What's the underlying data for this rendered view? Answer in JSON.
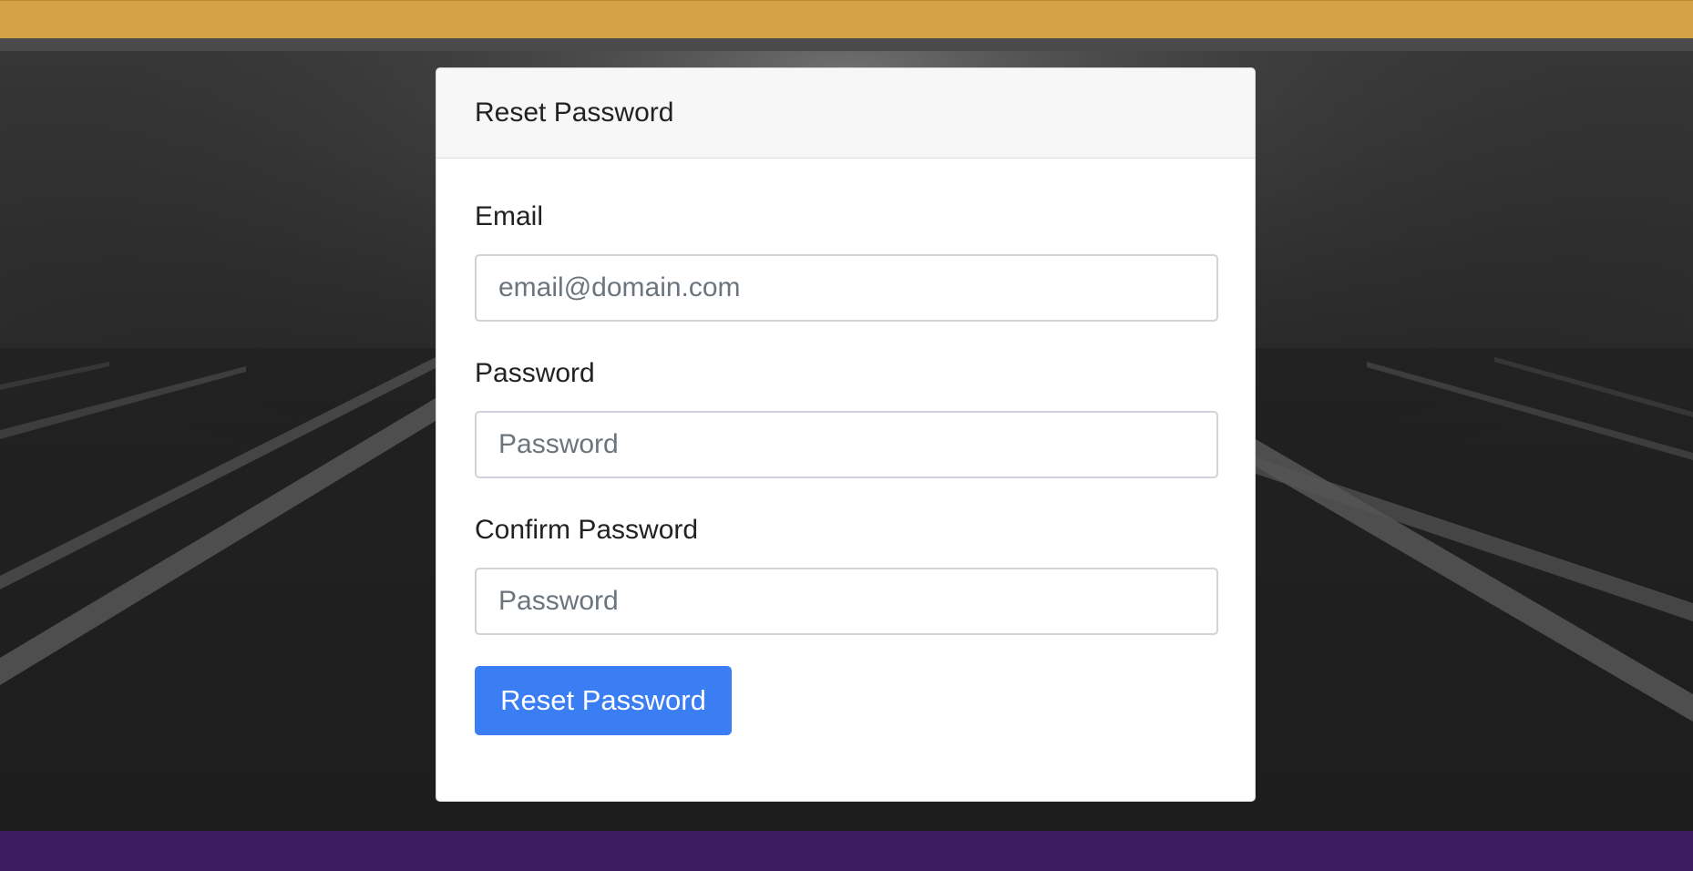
{
  "colors": {
    "top_bar": "#d4a247",
    "bottom_bar": "#3e1b63",
    "button": "#3b7ef4",
    "background": "#1a1a1a"
  },
  "card": {
    "title": "Reset Password"
  },
  "form": {
    "email": {
      "label": "Email",
      "placeholder": "email@domain.com",
      "value": ""
    },
    "password": {
      "label": "Password",
      "placeholder": "Password",
      "value": ""
    },
    "confirm_password": {
      "label": "Confirm Password",
      "placeholder": "Password",
      "value": ""
    },
    "submit_label": "Reset Password"
  }
}
